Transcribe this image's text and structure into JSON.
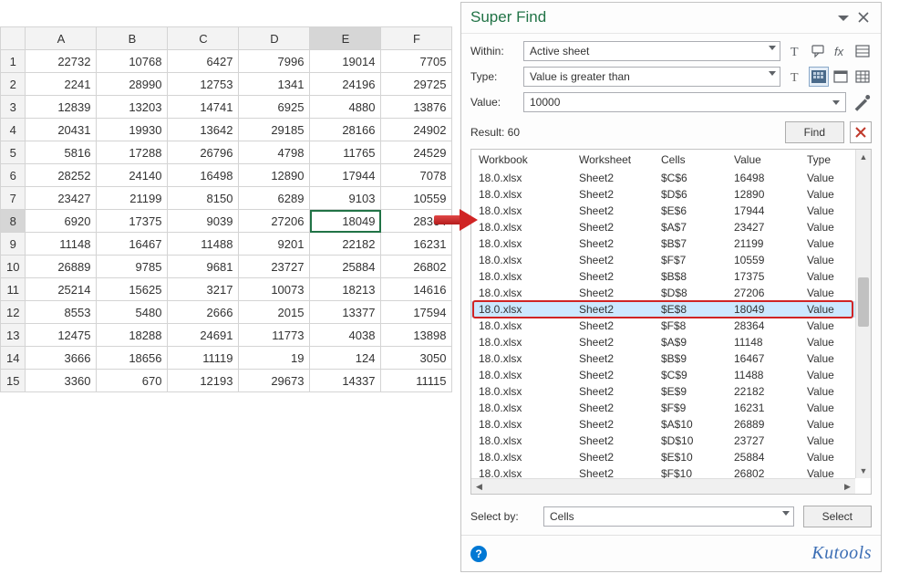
{
  "sheet": {
    "columns": [
      "A",
      "B",
      "C",
      "D",
      "E",
      "F"
    ],
    "row_start": 1,
    "row_end": 15,
    "active_col": "E",
    "active_row": 8,
    "data": [
      [
        22732,
        10768,
        6427,
        7996,
        19014,
        7705
      ],
      [
        2241,
        28990,
        12753,
        1341,
        24196,
        29725
      ],
      [
        12839,
        13203,
        14741,
        6925,
        4880,
        13876
      ],
      [
        20431,
        19930,
        13642,
        29185,
        28166,
        24902
      ],
      [
        5816,
        17288,
        26796,
        4798,
        11765,
        24529
      ],
      [
        28252,
        24140,
        16498,
        12890,
        17944,
        7078
      ],
      [
        23427,
        21199,
        8150,
        6289,
        9103,
        10559
      ],
      [
        6920,
        17375,
        9039,
        27206,
        18049,
        28364
      ],
      [
        11148,
        16467,
        11488,
        9201,
        22182,
        16231
      ],
      [
        26889,
        9785,
        9681,
        23727,
        25884,
        26802
      ],
      [
        25214,
        15625,
        3217,
        10073,
        18213,
        14616
      ],
      [
        8553,
        5480,
        2666,
        2015,
        13377,
        17594
      ],
      [
        12475,
        18288,
        24691,
        11773,
        4038,
        13898
      ],
      [
        3666,
        18656,
        11119,
        19,
        124,
        3050
      ],
      [
        3360,
        670,
        12193,
        29673,
        14337,
        11115
      ]
    ]
  },
  "panel": {
    "title": "Super Find",
    "labels": {
      "within": "Within:",
      "type": "Type:",
      "value": "Value:",
      "selectby": "Select by:"
    },
    "within": "Active sheet",
    "type": "Value is greater than",
    "value": "10000",
    "selectby": "Cells",
    "result_label": "Result: 60",
    "find_label": "Find",
    "select_label": "Select",
    "headers": {
      "workbook": "Workbook",
      "worksheet": "Worksheet",
      "cells": "Cells",
      "value": "Value",
      "type": "Type"
    },
    "selected_index": 8,
    "rows": [
      {
        "workbook": "18.0.xlsx",
        "worksheet": "Sheet2",
        "cells": "$C$6",
        "value": "16498",
        "type": "Value"
      },
      {
        "workbook": "18.0.xlsx",
        "worksheet": "Sheet2",
        "cells": "$D$6",
        "value": "12890",
        "type": "Value"
      },
      {
        "workbook": "18.0.xlsx",
        "worksheet": "Sheet2",
        "cells": "$E$6",
        "value": "17944",
        "type": "Value"
      },
      {
        "workbook": "18.0.xlsx",
        "worksheet": "Sheet2",
        "cells": "$A$7",
        "value": "23427",
        "type": "Value"
      },
      {
        "workbook": "18.0.xlsx",
        "worksheet": "Sheet2",
        "cells": "$B$7",
        "value": "21199",
        "type": "Value"
      },
      {
        "workbook": "18.0.xlsx",
        "worksheet": "Sheet2",
        "cells": "$F$7",
        "value": "10559",
        "type": "Value"
      },
      {
        "workbook": "18.0.xlsx",
        "worksheet": "Sheet2",
        "cells": "$B$8",
        "value": "17375",
        "type": "Value"
      },
      {
        "workbook": "18.0.xlsx",
        "worksheet": "Sheet2",
        "cells": "$D$8",
        "value": "27206",
        "type": "Value"
      },
      {
        "workbook": "18.0.xlsx",
        "worksheet": "Sheet2",
        "cells": "$E$8",
        "value": "18049",
        "type": "Value"
      },
      {
        "workbook": "18.0.xlsx",
        "worksheet": "Sheet2",
        "cells": "$F$8",
        "value": "28364",
        "type": "Value"
      },
      {
        "workbook": "18.0.xlsx",
        "worksheet": "Sheet2",
        "cells": "$A$9",
        "value": "11148",
        "type": "Value"
      },
      {
        "workbook": "18.0.xlsx",
        "worksheet": "Sheet2",
        "cells": "$B$9",
        "value": "16467",
        "type": "Value"
      },
      {
        "workbook": "18.0.xlsx",
        "worksheet": "Sheet2",
        "cells": "$C$9",
        "value": "11488",
        "type": "Value"
      },
      {
        "workbook": "18.0.xlsx",
        "worksheet": "Sheet2",
        "cells": "$E$9",
        "value": "22182",
        "type": "Value"
      },
      {
        "workbook": "18.0.xlsx",
        "worksheet": "Sheet2",
        "cells": "$F$9",
        "value": "16231",
        "type": "Value"
      },
      {
        "workbook": "18.0.xlsx",
        "worksheet": "Sheet2",
        "cells": "$A$10",
        "value": "26889",
        "type": "Value"
      },
      {
        "workbook": "18.0.xlsx",
        "worksheet": "Sheet2",
        "cells": "$D$10",
        "value": "23727",
        "type": "Value"
      },
      {
        "workbook": "18.0.xlsx",
        "worksheet": "Sheet2",
        "cells": "$E$10",
        "value": "25884",
        "type": "Value"
      },
      {
        "workbook": "18.0.xlsx",
        "worksheet": "Sheet2",
        "cells": "$F$10",
        "value": "26802",
        "type": "Value"
      }
    ],
    "brand": "Kutools"
  }
}
